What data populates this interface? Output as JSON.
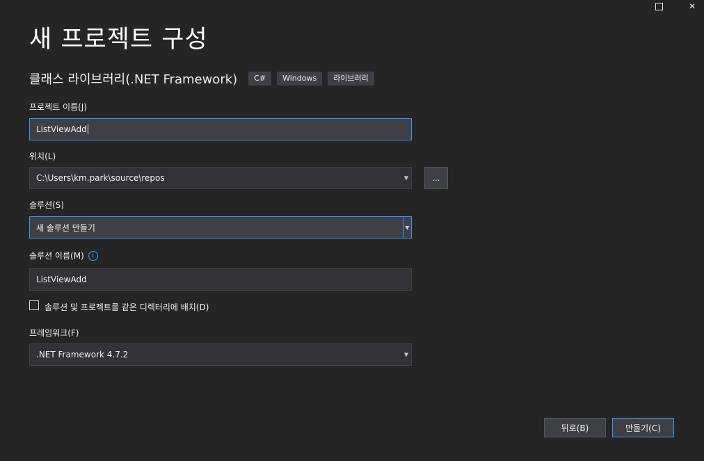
{
  "window": {
    "maximize_icon": "maximize-icon",
    "close_icon": "close-icon",
    "close_glyph": "✕"
  },
  "header": {
    "title": "새 프로젝트 구성",
    "template_name": "클래스 라이브러리(.NET Framework)",
    "tags": [
      "C#",
      "Windows",
      "라이브러리"
    ]
  },
  "form": {
    "project_name": {
      "label": "프로젝트 이름(J)",
      "value": "ListViewAdd"
    },
    "location": {
      "label": "위치(L)",
      "value": "C:\\Users\\km.park\\source\\repos",
      "browse_label": "..."
    },
    "solution": {
      "label": "솔루션(S)",
      "value": "새 솔루션 만들기"
    },
    "solution_name": {
      "label": "솔루션 이름(M)",
      "info_glyph": "i",
      "value": "ListViewAdd"
    },
    "same_directory": {
      "label": "솔루션 및 프로젝트를 같은 디렉터리에 배치(D)",
      "checked": false
    },
    "framework": {
      "label": "프레임워크(F)",
      "value": ".NET Framework 4.7.2"
    }
  },
  "footer": {
    "back_label": "뒤로(B)",
    "create_label": "만들기(C)"
  },
  "colors": {
    "background": "#252526",
    "field": "#333337",
    "accent": "#3399ff",
    "text": "#f1f1f1"
  }
}
